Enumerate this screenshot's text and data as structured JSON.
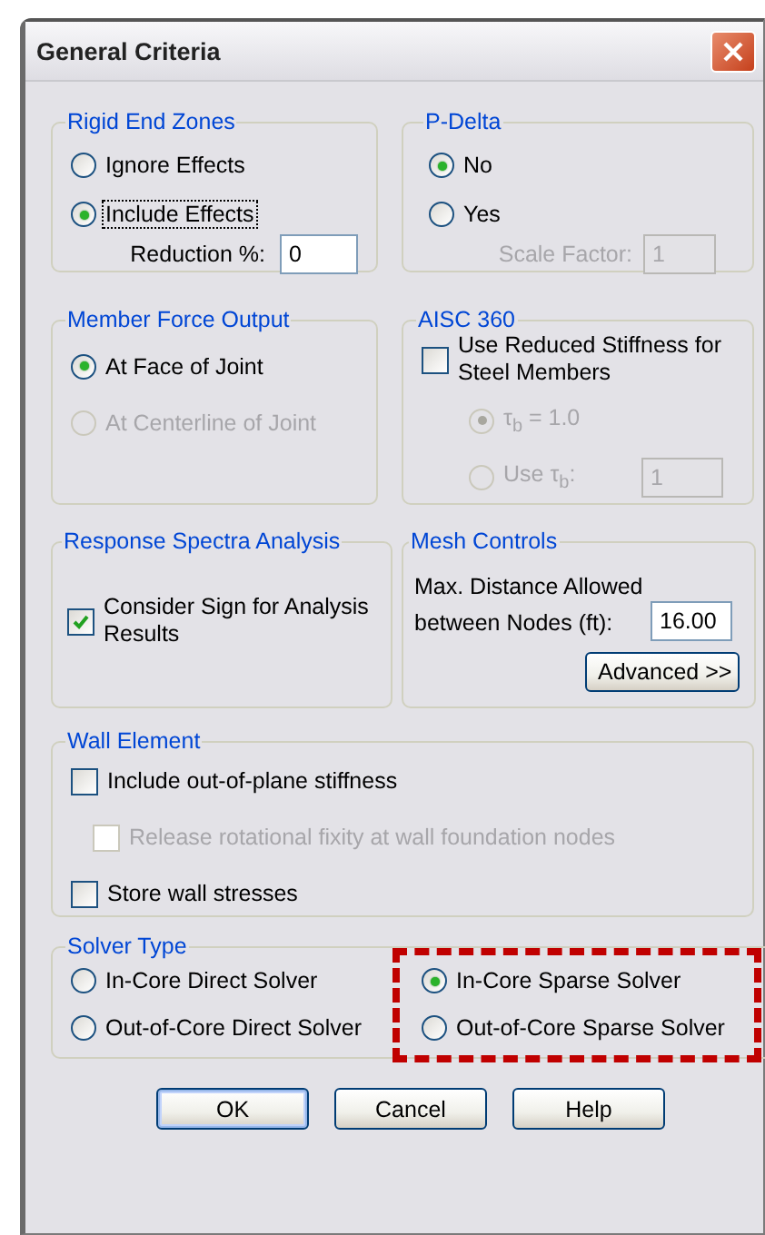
{
  "window": {
    "title": "General Criteria"
  },
  "rigid_end_zones": {
    "title": "Rigid End Zones",
    "options": [
      {
        "label": "Ignore Effects",
        "selected": false,
        "focused": false
      },
      {
        "label": "Include Effects",
        "selected": true,
        "focused": true
      }
    ],
    "reduction": {
      "label": "Reduction %:",
      "value": "0",
      "disabled": false
    }
  },
  "p_delta": {
    "title": "P-Delta",
    "options": [
      {
        "label": "No",
        "selected": true
      },
      {
        "label": "Yes",
        "selected": false
      }
    ],
    "scale_factor": {
      "label": "Scale Factor:",
      "value": "1",
      "disabled": true
    }
  },
  "member_force_output": {
    "title": "Member Force Output",
    "options": [
      {
        "label": "At Face of Joint",
        "selected": true,
        "disabled": false
      },
      {
        "label": "At Centerline of Joint",
        "selected": false,
        "disabled": true
      }
    ]
  },
  "aisc_360": {
    "title": "AISC 360",
    "reduced_stiffness": {
      "label": "Use Reduced Stiffness for Steel Members",
      "checked": false
    },
    "options": [
      {
        "label": "τ$_{b}$ = 1.0",
        "selected": true,
        "disabled": true
      },
      {
        "label": "Use  τ$_{b}$:",
        "selected": false,
        "disabled": true
      }
    ],
    "tau_value": {
      "value": "1",
      "disabled": true
    }
  },
  "response_spectra_analysis": {
    "title": "Response Spectra Analysis",
    "consider_sign": {
      "label": "Consider Sign for Analysis Results",
      "checked": true
    }
  },
  "mesh_controls": {
    "title": "Mesh Controls",
    "max_distance": {
      "label": "Max. Distance Allowed between Nodes (ft):",
      "value": "16.00",
      "disabled": false
    },
    "advanced_button": "Advanced >>"
  },
  "wall_element": {
    "title": "Wall Element",
    "options": [
      {
        "label": "Include out-of-plane stiffness",
        "checked": false,
        "disabled": false,
        "children": [
          {
            "label": "Release rotational fixity at wall foundation nodes",
            "checked": false,
            "disabled": true
          }
        ]
      },
      {
        "label": "Store wall stresses",
        "checked": false,
        "disabled": false
      }
    ]
  },
  "solver_type": {
    "title": "Solver Type",
    "columns": [
      {
        "highlighted": false,
        "options": [
          {
            "label": "In-Core Direct Solver",
            "selected": false
          },
          {
            "label": "Out-of-Core Direct Solver",
            "selected": false
          }
        ]
      },
      {
        "highlighted": true,
        "options": [
          {
            "label": "In-Core Sparse Solver",
            "selected": true
          },
          {
            "label": "Out-of-Core Sparse Solver",
            "selected": false
          }
        ]
      }
    ]
  },
  "buttons": [
    {
      "label": "OK",
      "default": true
    },
    {
      "label": "Cancel",
      "default": false
    },
    {
      "label": "Help",
      "default": false
    }
  ]
}
